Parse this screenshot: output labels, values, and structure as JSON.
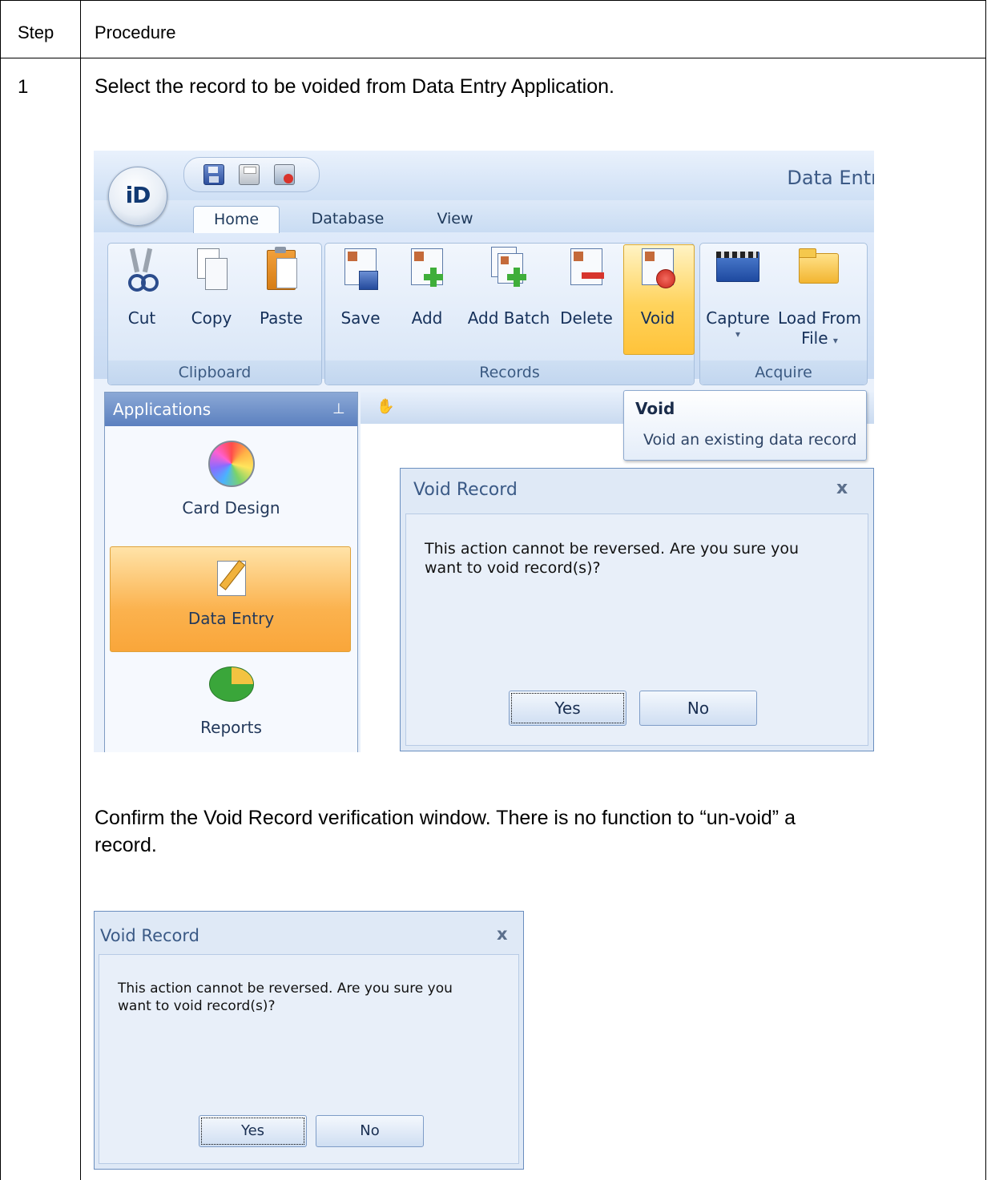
{
  "table": {
    "headers": [
      "Step",
      "Procedure"
    ],
    "step_number": "1",
    "instruction_1": "Select the record to be voided from Data Entry Application.",
    "instruction_2_line1": "Confirm the Void Record verification window. There is no function to “un-void” a",
    "instruction_2_line2": "record."
  },
  "app": {
    "logo_text": "iD",
    "title": "Data Entr",
    "tabs": [
      "Home",
      "Database",
      "View"
    ],
    "active_tab": "Home",
    "groups": {
      "clipboard": {
        "label": "Clipboard",
        "buttons": [
          "Cut",
          "Copy",
          "Paste"
        ]
      },
      "records": {
        "label": "Records",
        "buttons": [
          "Save",
          "Add",
          "Add Batch",
          "Delete",
          "Void"
        ]
      },
      "acquire": {
        "label": "Acquire",
        "buttons": [
          "Capture",
          "Load From",
          "File"
        ]
      }
    },
    "dropdown_arrow": "▾",
    "highlighted_button": "Void",
    "sidebar": {
      "title": "Applications",
      "pin": "ᵖ",
      "items": [
        "Card Design",
        "Data Entry",
        "Reports"
      ],
      "active_item": "Data Entry"
    },
    "tooltip": {
      "title": "Void",
      "description": "Void an existing data record"
    }
  },
  "dialog": {
    "title": "Void Record",
    "close": "x",
    "message_line1": "This action cannot be reversed. Are you sure you",
    "message_line2": "want to void record(s)?",
    "yes_label": "Yes",
    "no_label": "No"
  },
  "colors": {
    "ribbon_bg": "#dfeafa",
    "highlight": "#ffd35c",
    "sidebar_header": "#5b80bf",
    "dialog_title": "#3b5a86"
  }
}
